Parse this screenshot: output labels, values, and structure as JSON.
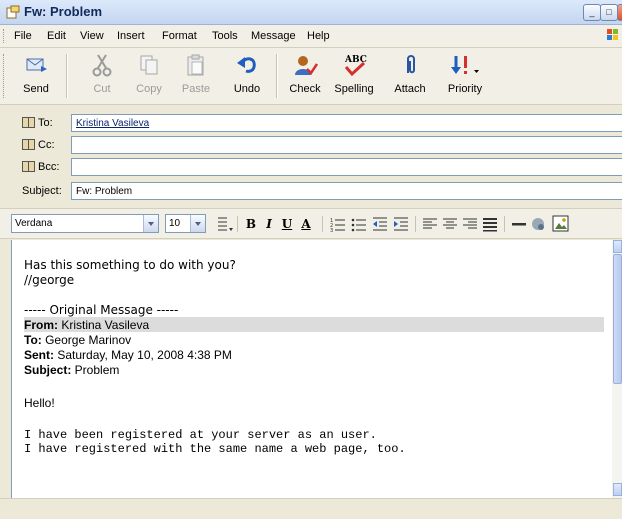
{
  "window": {
    "title": "Fw: Problem"
  },
  "menu": [
    "File",
    "Edit",
    "View",
    "Insert",
    "Format",
    "Tools",
    "Message",
    "Help"
  ],
  "toolbar": [
    {
      "label": "Send",
      "icon": "send-icon",
      "enabled": true
    },
    {
      "label": "Cut",
      "icon": "cut-icon",
      "enabled": false
    },
    {
      "label": "Copy",
      "icon": "copy-icon",
      "enabled": false
    },
    {
      "label": "Paste",
      "icon": "paste-icon",
      "enabled": false
    },
    {
      "label": "Undo",
      "icon": "undo-icon",
      "enabled": true
    },
    {
      "label": "Check",
      "icon": "check-names-icon",
      "enabled": true
    },
    {
      "label": "Spelling",
      "icon": "spelling-icon",
      "enabled": true
    },
    {
      "label": "Attach",
      "icon": "paperclip-icon",
      "enabled": true
    },
    {
      "label": "Priority",
      "icon": "priority-icon",
      "enabled": true
    }
  ],
  "headers": {
    "to": {
      "label": "To:",
      "value": "Kristina Vasileva"
    },
    "cc": {
      "label": "Cc:",
      "value": ""
    },
    "bcc": {
      "label": "Bcc:",
      "value": ""
    },
    "subject": {
      "label": "Subject:",
      "value": "Fw: Problem"
    }
  },
  "format": {
    "font": "Verdana",
    "size": "10"
  },
  "body": {
    "line1": "Has this something to do with you?",
    "line2": "//george",
    "original_sep": "----- Original Message -----",
    "from_label": "From:",
    "from_value": " Kristina Vasileva",
    "to_label": "To:",
    "to_value": " George Marinov",
    "sent_label": "Sent:",
    "sent_value": " Saturday, May 10, 2008 4:38 PM",
    "subject_label": "Subject:",
    "subject_value": " Problem",
    "hello": "Hello!",
    "p1": "I have been registered at your server as an user.",
    "p2": "I have registered with the same name a web page, too."
  },
  "colors": {
    "titlebar": "#c4d5f0",
    "chrome": "#ece9d8",
    "field_border": "#7f9db9",
    "highlight": "#dcdcdc"
  }
}
